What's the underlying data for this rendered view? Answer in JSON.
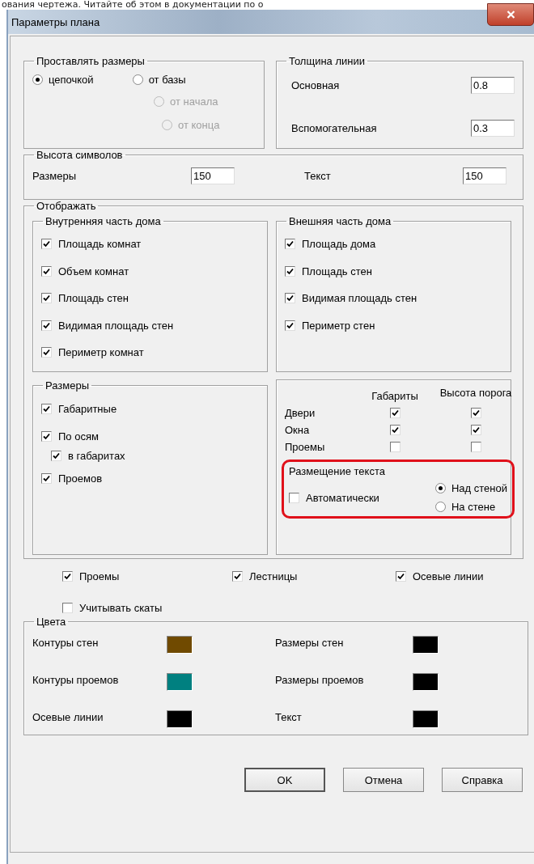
{
  "background_text": "ования чертежа. Читайте об этом в документации по о",
  "window": {
    "title": "Параметры плана"
  },
  "dimension_placement": {
    "label": "Проставлять размеры",
    "options": [
      {
        "label": "цепочкой",
        "selected": true,
        "disabled": false
      },
      {
        "label": "от базы",
        "selected": false,
        "disabled": false
      },
      {
        "label": "от начала",
        "selected": false,
        "disabled": true
      },
      {
        "label": "от конца",
        "selected": false,
        "disabled": true
      }
    ]
  },
  "line_thickness": {
    "label": "Толщина линии",
    "fields": [
      {
        "label": "Основная",
        "value": "0.8"
      },
      {
        "label": "Вспомогательная",
        "value": "0.3"
      }
    ]
  },
  "symbol_height": {
    "label": "Высота символов",
    "fields": [
      {
        "label": "Размеры",
        "value": "150"
      },
      {
        "label": "Текст",
        "value": "150"
      }
    ]
  },
  "display": {
    "label": "Отображать",
    "interior": {
      "label": "Внутренняя часть дома",
      "items": [
        {
          "label": "Площадь комнат",
          "checked": true
        },
        {
          "label": "Объем комнат",
          "checked": true
        },
        {
          "label": "Площадь стен",
          "checked": true
        },
        {
          "label": "Видимая площадь стен",
          "checked": true
        },
        {
          "label": "Периметр комнат",
          "checked": true
        }
      ]
    },
    "exterior": {
      "label": "Внешняя часть дома",
      "items": [
        {
          "label": "Площадь дома",
          "checked": true
        },
        {
          "label": "Площадь стен",
          "checked": true
        },
        {
          "label": "Видимая площадь стен",
          "checked": true
        },
        {
          "label": "Периметр стен",
          "checked": true
        }
      ]
    },
    "dimensions": {
      "label": "Размеры",
      "items": [
        {
          "label": "Габаритные",
          "checked": true
        },
        {
          "label": "По осям",
          "checked": true,
          "children": [
            {
              "label": "в габаритах",
              "checked": true
            }
          ]
        },
        {
          "label": "Проемов",
          "checked": true
        }
      ]
    },
    "openings_table": {
      "columns": [
        "Габариты",
        "Высота порога"
      ],
      "rows": [
        {
          "label": "Двери",
          "checks": [
            {
              "checked": true
            },
            {
              "checked": true
            }
          ]
        },
        {
          "label": "Окна",
          "checks": [
            {
              "checked": true
            },
            {
              "checked": true
            }
          ]
        },
        {
          "label": "Проемы",
          "checks": [
            {
              "checked": false
            },
            {
              "checked": false
            }
          ]
        }
      ]
    },
    "text_placement": {
      "label": "Размещение текста",
      "highlighted": true,
      "auto": {
        "label": "Автоматически",
        "checked": false
      },
      "options": [
        {
          "label": "Над стеной",
          "selected": true
        },
        {
          "label": "На стене",
          "selected": false
        }
      ]
    },
    "flags": [
      {
        "label": "Проемы",
        "checked": true
      },
      {
        "label": "Лестницы",
        "checked": true
      },
      {
        "label": "Осевые линии",
        "checked": true
      },
      {
        "label": "Учитывать скаты",
        "checked": false
      }
    ]
  },
  "colors": {
    "label": "Цвета",
    "items": [
      {
        "label": "Контуры стен",
        "color": "#704a00"
      },
      {
        "label": "Размеры стен",
        "color": "#000000"
      },
      {
        "label": "Контуры проемов",
        "color": "#008080"
      },
      {
        "label": "Размеры проемов",
        "color": "#000000"
      },
      {
        "label": "Осевые линии",
        "color": "#000000"
      },
      {
        "label": "Текст",
        "color": "#000000"
      }
    ]
  },
  "buttons": [
    {
      "label": "OK",
      "default": true
    },
    {
      "label": "Отмена",
      "default": false
    },
    {
      "label": "Справка",
      "default": false
    }
  ]
}
